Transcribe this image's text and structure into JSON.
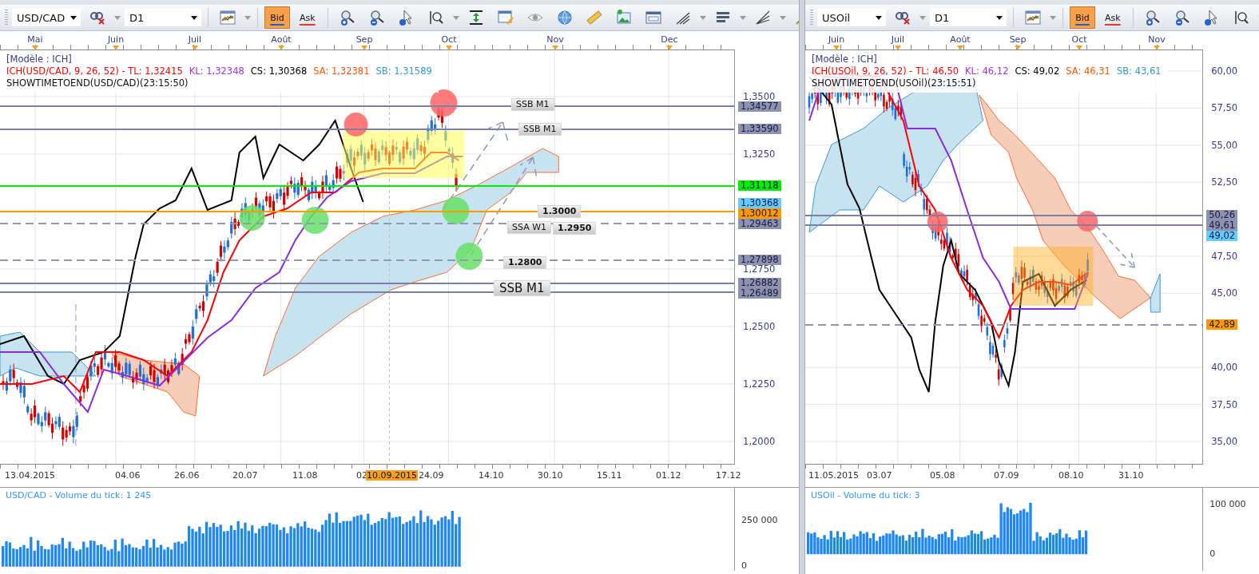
{
  "panels": [
    {
      "symbol": "USD/CAD",
      "timeframe": "D1",
      "quote_buttons": [
        {
          "label": "Bid",
          "selected": true
        },
        {
          "label": "Ask",
          "selected": false
        }
      ],
      "months": [
        "Mai",
        "Juin",
        "Juil",
        "Août",
        "Sep",
        "Oct",
        "Nov",
        "Dec"
      ],
      "legend": {
        "model": "[Modèle : ICH]",
        "values": [
          {
            "text": "ICH(USD/CAD, 9, 26, 52) -  TL: 1,32415",
            "color": "#ff0000"
          },
          {
            "text": "KL: 1,32348",
            "color": "#9933ff"
          },
          {
            "text": "CS: 1,30368",
            "color": "#000000"
          },
          {
            "text": "SA: 1,32381",
            "color": "#ff5500"
          },
          {
            "text": "SB: 1,31589",
            "color": "#3399cc"
          }
        ],
        "timer": "SHOWTIMETOEND(USD/CAD)(23:15:50)"
      },
      "price_ticks": [
        "1,3500",
        "1,3250",
        "1,2750",
        "1,2500",
        "1,2250",
        "1,2000"
      ],
      "price_labels": [
        {
          "text": "1,34577",
          "color": "#8c92b0",
          "kind": "level",
          "dashed": false
        },
        {
          "text": "1,33590",
          "color": "#8c92b0",
          "kind": "level",
          "dashed": false
        },
        {
          "text": "1,31118",
          "color": "#00ee00",
          "kind": "level",
          "dashed": false
        },
        {
          "text": "1,30368",
          "color": "#66ccff",
          "kind": "value"
        },
        {
          "text": "1,30012",
          "color": "#ff9900",
          "kind": "level",
          "dashed": false
        },
        {
          "text": "1,29463",
          "color": "#8c92b0",
          "kind": "level",
          "dashed": true
        },
        {
          "text": "1,27898",
          "color": "#8c92b0",
          "kind": "level",
          "dashed": true
        },
        {
          "text": "1,26882",
          "color": "#8c92b0",
          "kind": "level",
          "dashed": false
        },
        {
          "text": "1,26489",
          "color": "#8c92b0",
          "kind": "level",
          "dashed": false
        }
      ],
      "annotations": [
        {
          "text": "SSB M1",
          "kind": "tag"
        },
        {
          "text": "SSB M1",
          "kind": "tag"
        },
        {
          "text": "1.3000",
          "kind": "level"
        },
        {
          "text": "SSA W1",
          "kind": "tag"
        },
        {
          "text": "1.2950",
          "kind": "level"
        },
        {
          "text": "1.2800",
          "kind": "level"
        },
        {
          "text": "SSB M1",
          "kind": "tag-large"
        }
      ],
      "dates": [
        {
          "text": "13.04.2015",
          "selected": false
        },
        {
          "text": "04.06",
          "selected": false
        },
        {
          "text": "26.06",
          "selected": false
        },
        {
          "text": "20.07",
          "selected": false
        },
        {
          "text": "11.08",
          "selected": false
        },
        {
          "text": "02",
          "selected": false
        },
        {
          "text": "10.09.2015",
          "selected": true
        },
        {
          "text": "24.09",
          "selected": false
        },
        {
          "text": "14.10",
          "selected": false
        },
        {
          "text": "30.10",
          "selected": false
        },
        {
          "text": "15.11",
          "selected": false
        },
        {
          "text": "01.12",
          "selected": false
        },
        {
          "text": "17.12",
          "selected": false
        }
      ],
      "volume": {
        "title": "USD/CAD - Volume du tick: 1 245",
        "ticks": [
          "250 000",
          "0"
        ]
      }
    },
    {
      "symbol": "USOil",
      "timeframe": "D1",
      "quote_buttons": [
        {
          "label": "Bid",
          "selected": true
        },
        {
          "label": "Ask",
          "selected": false
        }
      ],
      "months": [
        "Juin",
        "Juil",
        "Août",
        "Sep",
        "Oct",
        "Nov"
      ],
      "legend": {
        "model": "[Modèle : ICH]",
        "values": [
          {
            "text": "ICH(USOil, 9, 26, 52) -  TL: 46,50",
            "color": "#ff0000"
          },
          {
            "text": "KL: 46,12",
            "color": "#9933ff"
          },
          {
            "text": "CS: 49,02",
            "color": "#000000"
          },
          {
            "text": "SA: 46,31",
            "color": "#ff5500"
          },
          {
            "text": "SB: 43,61",
            "color": "#3399cc"
          }
        ],
        "timer": "SHOWTIMETOEND(USOil)(23:15:51)"
      },
      "price_ticks": [
        "60,00",
        "57,50",
        "55,00",
        "52,50",
        "47,50",
        "45,00",
        "40,00",
        "37,50",
        "35,00"
      ],
      "price_labels": [
        {
          "text": "50,26",
          "color": "#8c92b0",
          "kind": "level",
          "dashed": false
        },
        {
          "text": "49,61",
          "color": "#8c92b0",
          "kind": "level",
          "dashed": false
        },
        {
          "text": "49,02",
          "color": "#66ccff",
          "kind": "value"
        },
        {
          "text": "42,89",
          "color": "#ff9900",
          "kind": "level",
          "dashed": true
        }
      ],
      "dates": [
        {
          "text": "11.05.2015",
          "selected": false
        },
        {
          "text": "03.07",
          "selected": false
        },
        {
          "text": "05.08",
          "selected": false
        },
        {
          "text": "07.09",
          "selected": false
        },
        {
          "text": "08.10",
          "selected": false
        },
        {
          "text": "31.10",
          "selected": false
        }
      ],
      "volume": {
        "title": "USOil - Volume du tick: 3",
        "ticks": [
          "100 000",
          "0"
        ]
      }
    }
  ]
}
